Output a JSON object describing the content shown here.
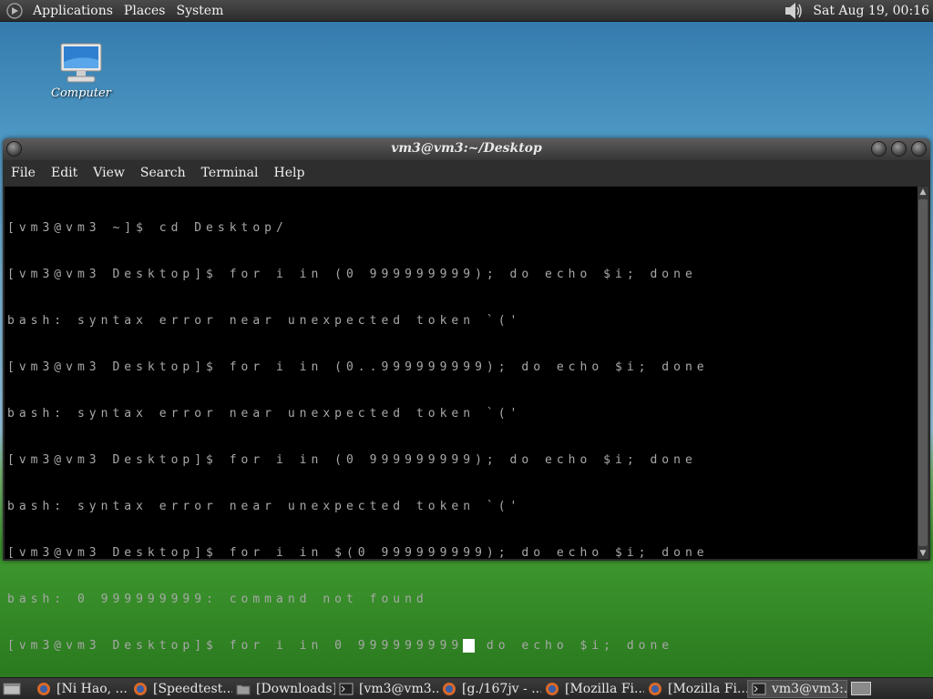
{
  "top_panel": {
    "menus": [
      "Applications",
      "Places",
      "System"
    ],
    "clock": "Sat Aug 19, 00:16"
  },
  "desktop": {
    "icons": [
      {
        "label": "Computer",
        "icon": "computer-icon"
      }
    ]
  },
  "terminal": {
    "title": "vm3@vm3:~/Desktop",
    "menu": [
      "File",
      "Edit",
      "View",
      "Search",
      "Terminal",
      "Help"
    ],
    "lines": [
      "[vm3@vm3 ~]$ cd Desktop/",
      "[vm3@vm3 Desktop]$ for i in (0 999999999); do echo $i; done",
      "bash: syntax error near unexpected token `('",
      "[vm3@vm3 Desktop]$ for i in (0..999999999); do echo $i; done",
      "bash: syntax error near unexpected token `('",
      "[vm3@vm3 Desktop]$ for i in (0 999999999); do echo $i; done",
      "bash: syntax error near unexpected token `('",
      "[vm3@vm3 Desktop]$ for i in $(0 999999999); do echo $i; done",
      "bash: 0 999999999: command not found"
    ],
    "prompt_before_cursor": "[vm3@vm3 Desktop]$ for i in 0 999999999",
    "prompt_after_cursor": " do echo $i; done"
  },
  "taskbar": {
    "tasks": [
      {
        "label": "[Ni Hao, ...",
        "icon": "firefox-icon",
        "active": false
      },
      {
        "label": "[Speedtest...",
        "icon": "firefox-icon",
        "active": false
      },
      {
        "label": "[Downloads]",
        "icon": "folder-icon",
        "active": false
      },
      {
        "label": "[vm3@vm3...",
        "icon": "terminal-icon",
        "active": false
      },
      {
        "label": "[g./167jv - ...",
        "icon": "firefox-icon",
        "active": false
      },
      {
        "label": "[Mozilla Fi...",
        "icon": "firefox-icon",
        "active": false
      },
      {
        "label": "[Mozilla Fi...",
        "icon": "firefox-icon",
        "active": false
      },
      {
        "label": "vm3@vm3:...",
        "icon": "terminal-icon",
        "active": true
      }
    ]
  }
}
